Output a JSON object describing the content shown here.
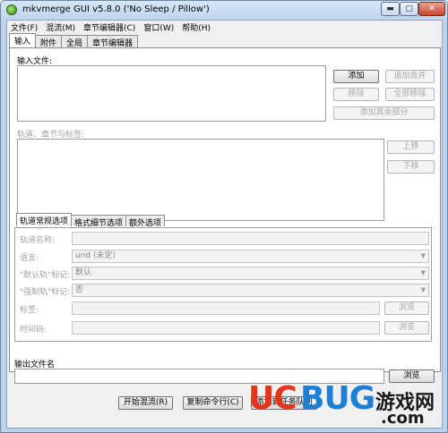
{
  "window": {
    "title": "mkvmerge GUI v5.8.0 ('No Sleep / Pillow')",
    "controls": {
      "minimize": "▬",
      "maximize": "▢",
      "close": "✕"
    }
  },
  "menubar": [
    "文件(F)",
    "混流(M)",
    "章节编辑器(C)",
    "窗口(W)",
    "帮助(H)"
  ],
  "tabs": [
    "输入",
    "附件",
    "全局",
    "章节编辑器"
  ],
  "input": {
    "files_label": "输入文件:",
    "buttons": {
      "add": "添加",
      "append": "追加合并",
      "remove": "移除",
      "remove_all": "全部移除",
      "add_other": "添加其余部分"
    },
    "tracks_label": "轨道、章节与标签:",
    "move_up": "上移",
    "move_down": "下移"
  },
  "subtabs": [
    "轨道常规选项",
    "格式细节选项",
    "额外选项"
  ],
  "track_options": {
    "name_label": "轨道名称:",
    "language_label": "语言:",
    "language_value": "und (未定)",
    "default_label": "\"默认轨\"标记:",
    "default_value": "默认",
    "forced_label": "\"强制轨\"标记:",
    "forced_value": "否",
    "tags_label": "标签:",
    "timecodes_label": "时间码:",
    "browse": "浏览"
  },
  "output": {
    "label": "输出文件名",
    "browse": "浏览"
  },
  "actions": {
    "start": "开始混流(R)",
    "copy_cmd": "复制命令行(C)",
    "add_job": "添加到任务队列"
  },
  "watermark": {
    "uc": "UC",
    "bug": "BUG",
    "cn": "游戏网",
    "com": ".com"
  }
}
